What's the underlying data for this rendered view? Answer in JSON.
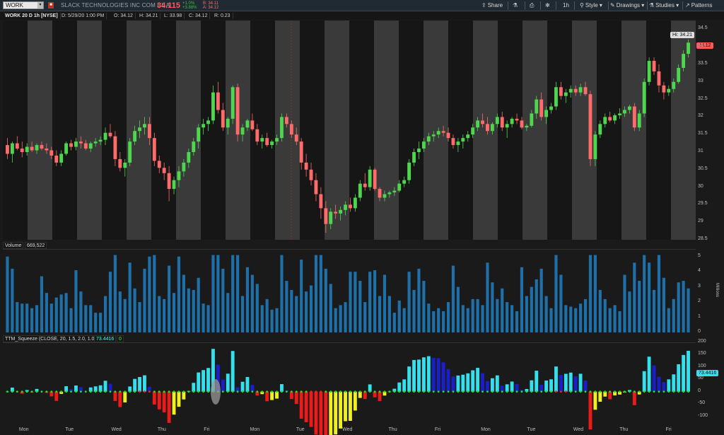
{
  "toolbar": {
    "symbol": "WORK",
    "company": "SLACK TECHNOLOGIES INC COM CL A",
    "last": "34.115",
    "change": "+1.0%",
    "change_pct": "+3.88%",
    "bid": "B: 34.11",
    "ask": "A: 34.12",
    "share_label": "Share",
    "interval_label": "1h",
    "style_label": "Style",
    "drawings_label": "Drawings",
    "studies_label": "Studies",
    "patterns_label": "Patterns"
  },
  "info": {
    "title": "WORK 20 D 1h [NYSE]",
    "date": "D: 5/29/20 1:00 PM",
    "open": "O: 34.12",
    "high": "H: 34.21",
    "low": "L: 33.98",
    "close": "C: 34.12",
    "range": "R: 0.23"
  },
  "price_panel": {
    "hi_label": "Hi: 34.21",
    "last_tag": "34.12",
    "y_ticks": [
      "34.5",
      "34",
      "33.5",
      "33",
      "32.5",
      "32",
      "31.5",
      "31",
      "30.5",
      "30",
      "29.5",
      "29",
      "28.5"
    ]
  },
  "volume_panel": {
    "label": "Volume",
    "value": "669,522",
    "y_ticks": [
      "5",
      "4",
      "3",
      "2",
      "1",
      "0"
    ],
    "unit": "Millions"
  },
  "squeeze_panel": {
    "label": "TTM_Squeeze (CLOSE, 20, 1.5, 2.0, 1.0)",
    "value": "73.4416",
    "value2": "0",
    "y_ticks": [
      "200",
      "150",
      "100",
      "50",
      "0",
      "-50",
      "-100"
    ]
  },
  "x_axis": [
    "Mon",
    "Tue",
    "Wed",
    "Thu",
    "Fri",
    "Mon",
    "Tue",
    "Wed",
    "Thu",
    "Fri",
    "Mon",
    "Tue",
    "Wed",
    "Thu",
    "Fri"
  ],
  "colors": {
    "up": "#4ed64e",
    "down": "#ff6b6b",
    "volume": "#1f6fa8",
    "sq_cyan": "#33e0ee",
    "sq_blue": "#1a1fc9",
    "sq_red": "#ee1a1a",
    "sq_yellow": "#f0f020",
    "dot_green": "#22dd22",
    "dot_red": "#ee2222"
  },
  "chart_data": {
    "type": "candlestick",
    "interval": "1h",
    "ohlc": [
      [
        31.2,
        31.4,
        30.8,
        30.95
      ],
      [
        30.95,
        31.3,
        30.7,
        31.25
      ],
      [
        31.25,
        31.45,
        31.05,
        31.1
      ],
      [
        31.1,
        31.3,
        30.85,
        31.0
      ],
      [
        31.0,
        31.25,
        30.9,
        31.15
      ],
      [
        31.15,
        31.3,
        31.0,
        31.05
      ],
      [
        31.05,
        31.25,
        30.95,
        31.2
      ],
      [
        31.2,
        31.3,
        31.05,
        31.1
      ],
      [
        31.1,
        31.25,
        30.95,
        31.05
      ],
      [
        31.05,
        31.15,
        30.8,
        30.9
      ],
      [
        30.9,
        31.05,
        30.6,
        30.7
      ],
      [
        30.7,
        31.05,
        30.6,
        30.95
      ],
      [
        30.95,
        31.3,
        30.9,
        31.25
      ],
      [
        31.25,
        31.35,
        31.05,
        31.15
      ],
      [
        31.15,
        31.4,
        31.05,
        31.3
      ],
      [
        31.3,
        31.45,
        31.1,
        31.25
      ],
      [
        31.25,
        31.35,
        31.05,
        31.1
      ],
      [
        31.1,
        31.3,
        31.0,
        31.25
      ],
      [
        31.25,
        31.4,
        31.15,
        31.3
      ],
      [
        31.3,
        31.45,
        31.2,
        31.35
      ],
      [
        31.35,
        31.7,
        31.2,
        31.55
      ],
      [
        31.55,
        31.8,
        31.4,
        31.45
      ],
      [
        31.45,
        31.6,
        30.6,
        30.8
      ],
      [
        30.8,
        31.0,
        30.45,
        30.55
      ],
      [
        30.55,
        30.8,
        30.3,
        30.7
      ],
      [
        30.7,
        31.4,
        30.6,
        31.3
      ],
      [
        31.3,
        31.75,
        31.2,
        31.6
      ],
      [
        31.6,
        31.9,
        31.4,
        31.7
      ],
      [
        31.7,
        32.0,
        31.5,
        31.8
      ],
      [
        31.8,
        32.0,
        31.2,
        31.4
      ],
      [
        31.4,
        31.55,
        30.6,
        30.75
      ],
      [
        30.75,
        30.9,
        30.4,
        30.55
      ],
      [
        30.55,
        30.7,
        30.2,
        30.4
      ],
      [
        30.4,
        30.6,
        29.6,
        29.95
      ],
      [
        29.95,
        30.3,
        29.8,
        30.2
      ],
      [
        30.2,
        30.6,
        30.0,
        30.45
      ],
      [
        30.45,
        30.8,
        30.3,
        30.7
      ],
      [
        30.7,
        31.1,
        30.55,
        31.0
      ],
      [
        31.0,
        31.4,
        30.9,
        31.3
      ],
      [
        31.3,
        31.8,
        31.1,
        31.7
      ],
      [
        31.7,
        31.95,
        31.5,
        31.8
      ],
      [
        31.8,
        32.0,
        31.6,
        31.9
      ],
      [
        31.9,
        32.9,
        31.8,
        32.7
      ],
      [
        32.7,
        33.0,
        32.1,
        32.2
      ],
      [
        32.2,
        32.4,
        31.6,
        31.7
      ],
      [
        31.7,
        32.0,
        31.5,
        31.95
      ],
      [
        31.95,
        32.9,
        31.8,
        32.85
      ],
      [
        32.85,
        32.95,
        31.3,
        31.5
      ],
      [
        31.5,
        31.8,
        31.3,
        31.7
      ],
      [
        31.7,
        31.95,
        31.6,
        31.9
      ],
      [
        31.9,
        32.1,
        31.6,
        31.65
      ],
      [
        31.65,
        31.8,
        31.2,
        31.3
      ],
      [
        31.3,
        31.5,
        31.1,
        31.4
      ],
      [
        31.4,
        31.55,
        31.15,
        31.2
      ],
      [
        31.2,
        31.35,
        31.1,
        31.3
      ],
      [
        31.3,
        31.5,
        31.2,
        31.4
      ],
      [
        31.4,
        32.1,
        31.3,
        32.0
      ],
      [
        32.0,
        32.1,
        31.7,
        31.8
      ],
      [
        31.8,
        31.9,
        31.4,
        31.5
      ],
      [
        31.5,
        31.7,
        31.2,
        31.3
      ],
      [
        31.3,
        31.4,
        30.5,
        30.7
      ],
      [
        30.7,
        30.95,
        30.3,
        30.5
      ],
      [
        30.5,
        30.7,
        30.05,
        30.2
      ],
      [
        30.2,
        30.4,
        29.6,
        29.8
      ],
      [
        29.8,
        30.0,
        29.1,
        29.4
      ],
      [
        29.4,
        29.6,
        28.7,
        28.95
      ],
      [
        28.95,
        29.4,
        28.8,
        29.3
      ],
      [
        29.3,
        29.5,
        29.1,
        29.25
      ],
      [
        29.25,
        29.45,
        29.05,
        29.35
      ],
      [
        29.35,
        29.6,
        29.2,
        29.5
      ],
      [
        29.5,
        29.7,
        29.3,
        29.4
      ],
      [
        29.4,
        29.8,
        29.3,
        29.7
      ],
      [
        29.7,
        30.2,
        29.6,
        30.1
      ],
      [
        30.1,
        30.4,
        29.9,
        30.0
      ],
      [
        30.0,
        30.6,
        29.9,
        30.5
      ],
      [
        30.5,
        30.55,
        29.9,
        29.95
      ],
      [
        29.95,
        30.0,
        29.6,
        29.7
      ],
      [
        29.7,
        29.9,
        29.6,
        29.8
      ],
      [
        29.8,
        29.9,
        29.7,
        29.85
      ],
      [
        29.85,
        30.0,
        29.75,
        29.9
      ],
      [
        29.9,
        30.2,
        29.85,
        30.1
      ],
      [
        30.1,
        30.3,
        30.0,
        30.2
      ],
      [
        30.2,
        30.8,
        30.1,
        30.7
      ],
      [
        30.7,
        31.1,
        30.6,
        31.0
      ],
      [
        31.0,
        31.3,
        30.8,
        31.1
      ],
      [
        31.1,
        31.4,
        31.0,
        31.3
      ],
      [
        31.3,
        31.55,
        31.2,
        31.45
      ],
      [
        31.45,
        31.6,
        31.3,
        31.5
      ],
      [
        31.5,
        31.7,
        31.4,
        31.6
      ],
      [
        31.6,
        31.75,
        31.45,
        31.55
      ],
      [
        31.55,
        31.7,
        31.3,
        31.4
      ],
      [
        31.4,
        31.5,
        31.1,
        31.2
      ],
      [
        31.2,
        31.4,
        31.0,
        31.3
      ],
      [
        31.3,
        31.5,
        31.1,
        31.4
      ],
      [
        31.4,
        31.6,
        31.3,
        31.5
      ],
      [
        31.5,
        31.8,
        31.4,
        31.7
      ],
      [
        31.7,
        32.0,
        31.6,
        31.9
      ],
      [
        31.9,
        32.1,
        31.7,
        31.8
      ],
      [
        31.8,
        32.0,
        31.5,
        31.6
      ],
      [
        31.6,
        31.85,
        31.5,
        31.8
      ],
      [
        31.8,
        32.1,
        31.7,
        32.0
      ],
      [
        32.0,
        32.15,
        31.6,
        31.7
      ],
      [
        31.7,
        31.9,
        31.4,
        31.8
      ],
      [
        31.8,
        32.0,
        31.7,
        31.95
      ],
      [
        31.95,
        32.1,
        31.8,
        31.9
      ],
      [
        31.9,
        32.0,
        31.65,
        31.7
      ],
      [
        31.7,
        31.8,
        31.6,
        31.75
      ],
      [
        31.75,
        32.2,
        31.7,
        32.1
      ],
      [
        32.1,
        32.6,
        31.95,
        32.5
      ],
      [
        32.5,
        32.7,
        31.9,
        32.0
      ],
      [
        32.0,
        32.3,
        31.8,
        32.2
      ],
      [
        32.2,
        32.4,
        32.1,
        32.3
      ],
      [
        32.3,
        33.0,
        32.2,
        32.85
      ],
      [
        32.85,
        33.0,
        32.5,
        32.6
      ],
      [
        32.6,
        32.8,
        32.4,
        32.7
      ],
      [
        32.7,
        32.9,
        32.55,
        32.8
      ],
      [
        32.8,
        32.9,
        32.6,
        32.7
      ],
      [
        32.7,
        32.95,
        32.6,
        32.85
      ],
      [
        32.85,
        33.0,
        32.6,
        32.65
      ],
      [
        32.65,
        32.75,
        30.6,
        30.8
      ],
      [
        30.8,
        31.6,
        30.6,
        31.5
      ],
      [
        31.5,
        31.9,
        31.4,
        31.8
      ],
      [
        31.8,
        32.1,
        31.7,
        32.0
      ],
      [
        32.0,
        32.15,
        31.85,
        31.9
      ],
      [
        31.9,
        32.1,
        31.8,
        32.05
      ],
      [
        32.05,
        32.25,
        31.95,
        32.1
      ],
      [
        32.1,
        32.3,
        32.0,
        32.2
      ],
      [
        32.2,
        32.35,
        32.1,
        32.3
      ],
      [
        32.3,
        32.4,
        31.6,
        31.7
      ],
      [
        31.7,
        32.2,
        31.6,
        32.1
      ],
      [
        32.1,
        33.1,
        32.0,
        33.0
      ],
      [
        33.0,
        33.7,
        32.9,
        33.6
      ],
      [
        33.6,
        33.7,
        33.2,
        33.3
      ],
      [
        33.3,
        33.5,
        32.7,
        32.9
      ],
      [
        32.9,
        33.0,
        32.5,
        32.7
      ],
      [
        32.7,
        32.9,
        32.6,
        32.8
      ],
      [
        32.8,
        33.1,
        32.7,
        33.0
      ],
      [
        33.0,
        33.5,
        32.95,
        33.4
      ],
      [
        33.4,
        33.9,
        33.3,
        33.8
      ],
      [
        33.8,
        34.21,
        33.7,
        34.12
      ]
    ],
    "ylim": [
      28.5,
      34.75
    ]
  }
}
